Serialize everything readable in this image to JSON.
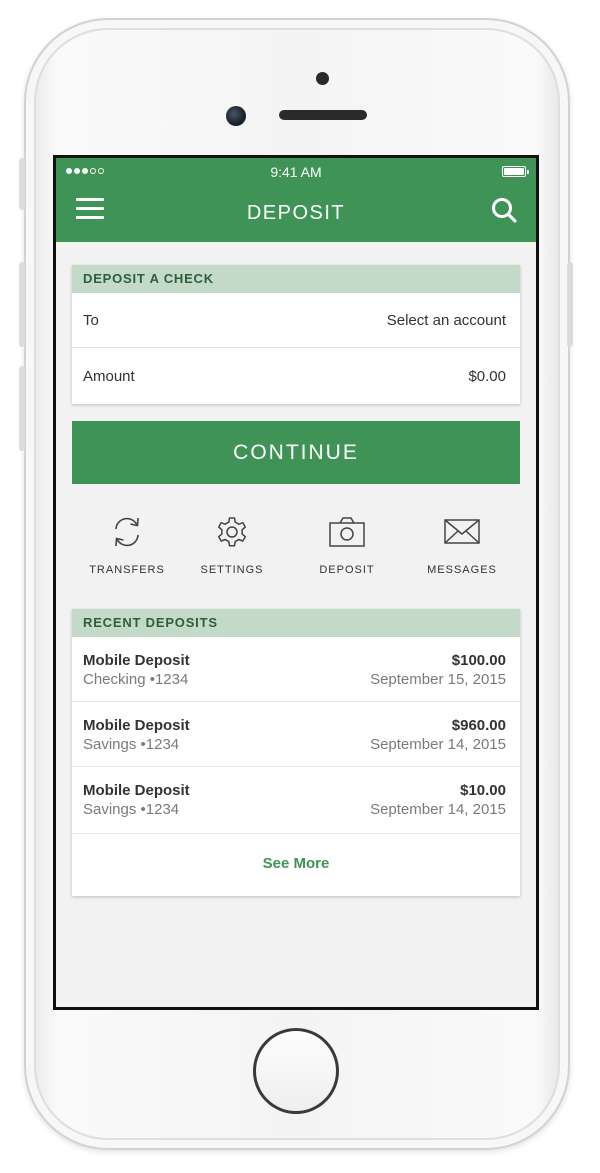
{
  "status_bar": {
    "time": "9:41 AM"
  },
  "nav": {
    "title": "DEPOSIT"
  },
  "deposit_check": {
    "header": "DEPOSIT A CHECK",
    "to_label": "To",
    "to_value": "Select an account",
    "amount_label": "Amount",
    "amount_value": "$0.00"
  },
  "continue_label": "CONTINUE",
  "actions": [
    {
      "label": "TRANSFERS",
      "icon": "refresh-icon"
    },
    {
      "label": "SETTINGS",
      "icon": "gear-icon"
    },
    {
      "label": "DEPOSIT",
      "icon": "camera-icon"
    },
    {
      "label": "MESSAGES",
      "icon": "envelope-icon"
    }
  ],
  "recent": {
    "header": "RECENT DEPOSITS",
    "items": [
      {
        "title": "Mobile Deposit",
        "account": "Checking •1234",
        "amount": "$100.00",
        "date": "September 15, 2015"
      },
      {
        "title": "Mobile Deposit",
        "account": "Savings •1234",
        "amount": "$960.00",
        "date": "September 14, 2015"
      },
      {
        "title": "Mobile Deposit",
        "account": "Savings •1234",
        "amount": "$10.00",
        "date": "September 14, 2015"
      }
    ],
    "see_more": "See More"
  },
  "colors": {
    "brand": "#3f9357",
    "header_tint": "#c3dac9"
  }
}
